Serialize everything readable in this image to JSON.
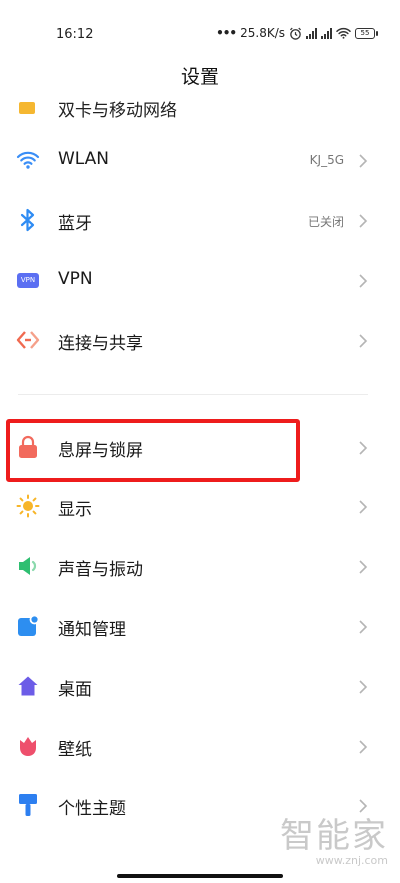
{
  "status_bar": {
    "time": "16:12",
    "speed": "25.8K/s",
    "battery": "55"
  },
  "header": {
    "title": "设置"
  },
  "cut_item": {
    "label": "双卡与移动网络"
  },
  "items": [
    {
      "id": "wlan",
      "label": "WLAN",
      "value": "KJ_5G",
      "icon": "wifi-icon",
      "color": "#3a8ef6"
    },
    {
      "id": "bluetooth",
      "label": "蓝牙",
      "value": "已关闭",
      "icon": "bluetooth-icon",
      "color": "#2f8cf3"
    },
    {
      "id": "vpn",
      "label": "VPN",
      "value": "",
      "icon": "vpn-icon",
      "icon_text": "VPN",
      "color": "#5b6ff2"
    },
    {
      "id": "connection-sharing",
      "label": "连接与共享",
      "value": "",
      "icon": "share-icon",
      "color": "#f06a50"
    },
    {
      "id": "lock-screen",
      "label": "息屏与锁屏",
      "value": "",
      "icon": "lock-icon",
      "color": "#f26a5d"
    },
    {
      "id": "display",
      "label": "显示",
      "value": "",
      "icon": "sun-icon",
      "color": "#f7b528"
    },
    {
      "id": "sound",
      "label": "声音与振动",
      "value": "",
      "icon": "speaker-icon",
      "color": "#2fbf71"
    },
    {
      "id": "notifications",
      "label": "通知管理",
      "value": "",
      "icon": "notification-icon",
      "color": "#2d8ef0"
    },
    {
      "id": "desktop",
      "label": "桌面",
      "value": "",
      "icon": "home-icon",
      "color": "#6c5ce7"
    },
    {
      "id": "wallpaper",
      "label": "壁纸",
      "value": "",
      "icon": "flower-icon",
      "color": "#ee4f6c"
    },
    {
      "id": "themes",
      "label": "个性主题",
      "value": "",
      "icon": "brush-icon",
      "color": "#2d7ff0"
    }
  ],
  "watermark": {
    "logo": "智能家",
    "url": "www.znj.com"
  }
}
